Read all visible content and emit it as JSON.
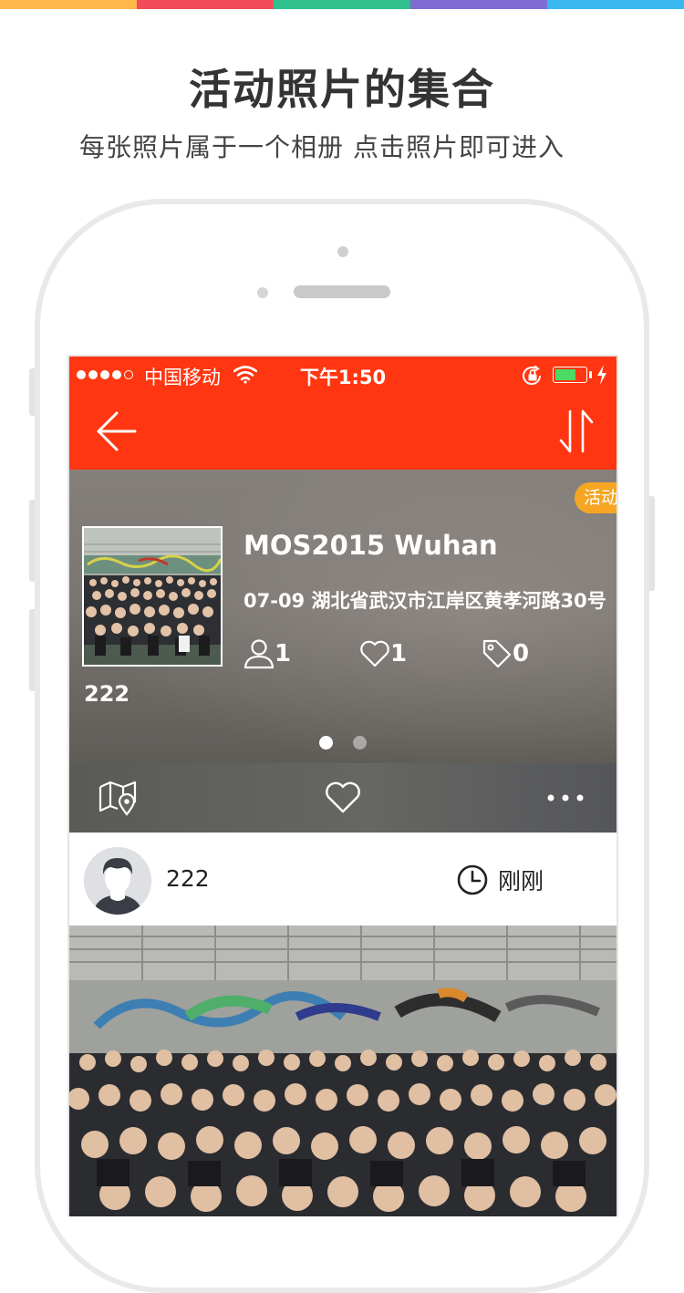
{
  "promo": {
    "title": "活动照片的集合",
    "subtitle": "每张照片属于一个相册 点击照片即可进入",
    "top_strip_colors": [
      "#ffb64a",
      "#f14b5a",
      "#2fc08e",
      "#7e6cd3",
      "#39b8ef"
    ]
  },
  "status_bar": {
    "signal_dots_filled": 4,
    "signal_dots_total": 5,
    "carrier": "中国移动",
    "time": "下午1:50",
    "battery_level": 0.7
  },
  "nav": {
    "back_icon": "arrow-left-icon",
    "sort_icon": "sort-arrows-icon"
  },
  "album": {
    "badge": "活动",
    "title": "MOS2015 Wuhan",
    "meta": "07-09 湖北省武汉市江岸区黄孝河路30号",
    "members": "1",
    "likes": "1",
    "tags": "0",
    "owner": "222",
    "pager_count": 2,
    "pager_active": 0
  },
  "actions": {
    "map_icon": "map-pin-icon",
    "like_icon": "heart-icon",
    "more_icon": "more-dots-icon"
  },
  "post": {
    "user": "222",
    "time": "刚刚"
  },
  "colors": {
    "brand": "#ff3611",
    "badge": "#f6a623",
    "battery": "#4cd964"
  }
}
